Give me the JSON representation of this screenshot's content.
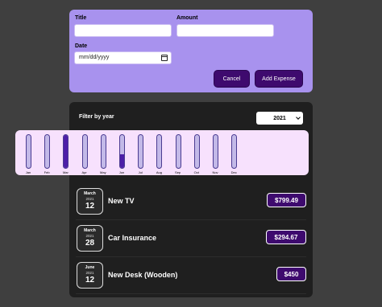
{
  "form": {
    "title_label": "Title",
    "title_value": "",
    "amount_label": "Amount",
    "amount_value": "",
    "date_label": "Date",
    "date_placeholder": "mm/dd/yyyy",
    "cancel_label": "Cancel",
    "submit_label": "Add Expense"
  },
  "filter": {
    "label": "Filter by year",
    "selected_year": "2021"
  },
  "chart_data": {
    "type": "bar",
    "categories": [
      "Jan",
      "Feb",
      "Mar",
      "Apr",
      "May",
      "Jun",
      "Jul",
      "Aug",
      "Sep",
      "Oct",
      "Nov",
      "Dec"
    ],
    "values": [
      0,
      0,
      1093.98,
      0,
      0,
      450,
      0,
      0,
      0,
      0,
      0,
      0
    ],
    "ylim": [
      0,
      1093.98
    ],
    "fill_color": "#4d1fa8",
    "track_color": "#c3b9e8"
  },
  "expenses": [
    {
      "month": "March",
      "year": "2021",
      "day": "12",
      "title": "New TV",
      "amount": "$799.49"
    },
    {
      "month": "March",
      "year": "2021",
      "day": "28",
      "title": "Car Insurance",
      "amount": "$294.67"
    },
    {
      "month": "June",
      "year": "2021",
      "day": "12",
      "title": "New Desk (Wooden)",
      "amount": "$450"
    }
  ],
  "colors": {
    "page_bg": "#3f3f3f",
    "form_bg": "#a892ee",
    "panel_bg": "#1f1f1f",
    "chart_bg": "#f7e1fd",
    "accent": "#3e0a6e"
  }
}
